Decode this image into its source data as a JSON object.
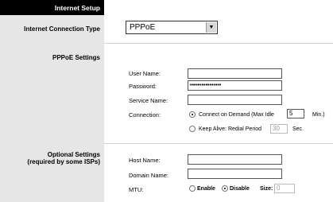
{
  "section": {
    "title": "Internet Setup"
  },
  "left": {
    "connection_type": "Internet Connection Type",
    "pppoe_settings": "PPPoE Settings",
    "optional_line1": "Optional Settings",
    "optional_line2": "(required by some ISPs)"
  },
  "connection_type": {
    "value": "PPPoE"
  },
  "pppoe": {
    "user_name_label": "User Name:",
    "user_name_value": "",
    "password_label": "Password:",
    "password_value": "••••••••••••••••",
    "service_name_label": "Service Name:",
    "service_name_value": "",
    "connection_label": "Connection:",
    "connect_on_demand_label": "Connect on Demand  (Max Idle",
    "max_idle_value": "5",
    "max_idle_unit": "Min.)",
    "keep_alive_label": "Keep Alive: Redial Period",
    "redial_period_value": "30",
    "redial_unit": "Sec."
  },
  "optional": {
    "host_name_label": "Host Name:",
    "host_name_value": "",
    "domain_name_label": "Domain Name:",
    "domain_name_value": "",
    "mtu_label": "MTU:",
    "mtu_enable": "Enable",
    "mtu_disable": "Disable",
    "size_label": "Size:",
    "size_value": "0"
  }
}
